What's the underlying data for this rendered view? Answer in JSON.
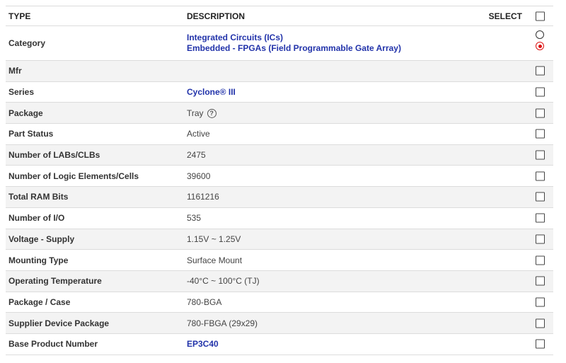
{
  "header": {
    "type": "TYPE",
    "description": "DESCRIPTION",
    "select": "SELECT"
  },
  "category": {
    "label": "Category",
    "line1": "Integrated Circuits (ICs)",
    "line2": "Embedded - FPGAs (Field Programmable Gate Array)",
    "selected_option": 2
  },
  "rows": [
    {
      "label": "Mfr",
      "value": "",
      "link": false
    },
    {
      "label": "Series",
      "value": "Cyclone® III",
      "link": true
    },
    {
      "label": "Package",
      "value": "Tray",
      "link": false,
      "help_icon": "question-circle-icon"
    },
    {
      "label": "Part Status",
      "value": "Active",
      "link": false
    },
    {
      "label": "Number of LABs/CLBs",
      "value": "2475",
      "link": false
    },
    {
      "label": "Number of Logic Elements/Cells",
      "value": "39600",
      "link": false
    },
    {
      "label": "Total RAM Bits",
      "value": "1161216",
      "link": false
    },
    {
      "label": "Number of I/O",
      "value": "535",
      "link": false
    },
    {
      "label": "Voltage - Supply",
      "value": "1.15V ~ 1.25V",
      "link": false
    },
    {
      "label": "Mounting Type",
      "value": "Surface Mount",
      "link": false
    },
    {
      "label": "Operating Temperature",
      "value": "-40°C ~ 100°C (TJ)",
      "link": false
    },
    {
      "label": "Package / Case",
      "value": "780-BGA",
      "link": false
    },
    {
      "label": "Supplier Device Package",
      "value": "780-FBGA (29x29)",
      "link": false
    },
    {
      "label": "Base Product Number",
      "value": "EP3C40",
      "link": true
    }
  ],
  "colors": {
    "link": "#2233aa",
    "radio_selected": "#dd1111",
    "alt_row": "#f3f3f3"
  }
}
